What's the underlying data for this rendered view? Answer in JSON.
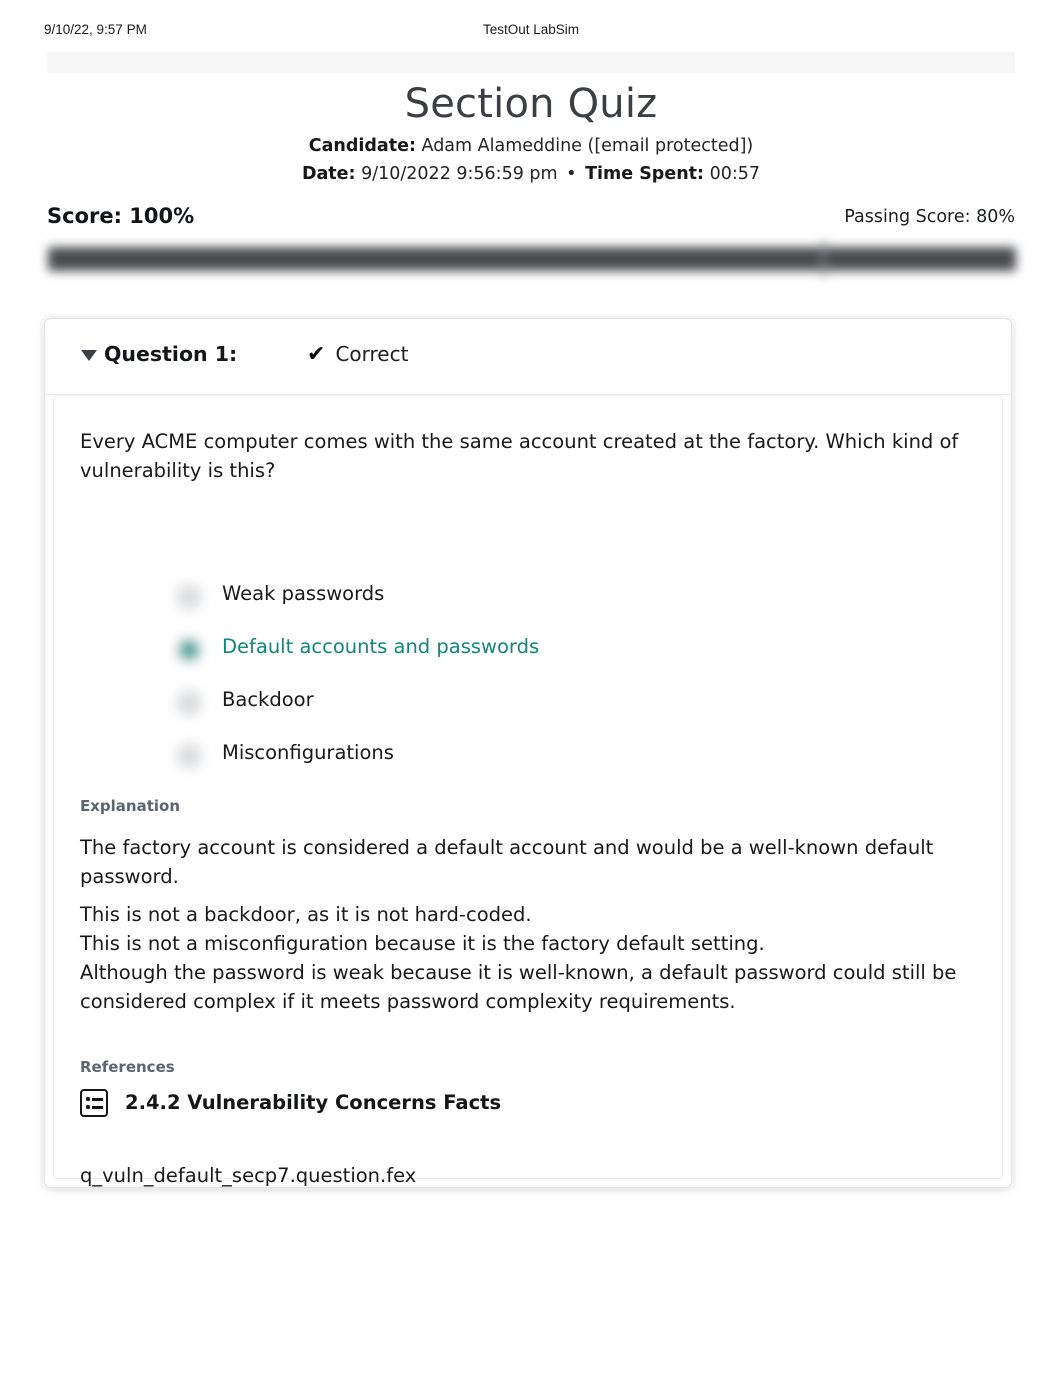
{
  "print_header": {
    "left": "9/10/22, 9:57 PM",
    "center": "TestOut LabSim"
  },
  "report": {
    "title": "Section Quiz",
    "candidate_label": "Candidate:",
    "candidate_value": "Adam Alameddine ([email protected])",
    "date_label": "Date:",
    "date_value": "9/10/2022 9:56:59 pm",
    "separator": "•",
    "time_spent_label": "Time Spent:",
    "time_spent_value": "00:57",
    "score_label": "Score: 100%",
    "passing_score_label": "Passing Score: 80%",
    "score_percent": 100,
    "passing_percent": 80
  },
  "question": {
    "caret_state": "expanded",
    "number_label": "Question 1:",
    "status_icon": "check-icon",
    "status_label": "Correct",
    "prompt": "Every ACME computer comes with the same account created at the factory. Which kind of vulnerability is this?",
    "options": [
      {
        "label": "Weak passwords",
        "selected": false
      },
      {
        "label": "Default accounts and passwords",
        "selected": true
      },
      {
        "label": "Backdoor",
        "selected": false
      },
      {
        "label": "Misconfigurations",
        "selected": false
      }
    ],
    "explanation_heading": "Explanation",
    "explanation_paragraph_1": "The factory account is considered a default account and would be a well-known default password.",
    "explanation_paragraph_2": "This is not a backdoor, as it is not hard-coded.\nThis is not a misconfiguration because it is the factory default setting.\nAlthough the password is weak because it is well-known, a default password could still be considered complex if it meets password complexity requirements.",
    "references_heading": "References",
    "reference_icon": "list-box-icon",
    "reference_title": "2.4.2 Vulnerability Concerns Facts",
    "filename": "q_vuln_default_secp7.question.fex"
  },
  "colors": {
    "accent_teal": "#0f877c",
    "title_gray": "#3b3f44",
    "section_head_gray": "#5b6570",
    "bar_dark": "#4a4d50"
  }
}
